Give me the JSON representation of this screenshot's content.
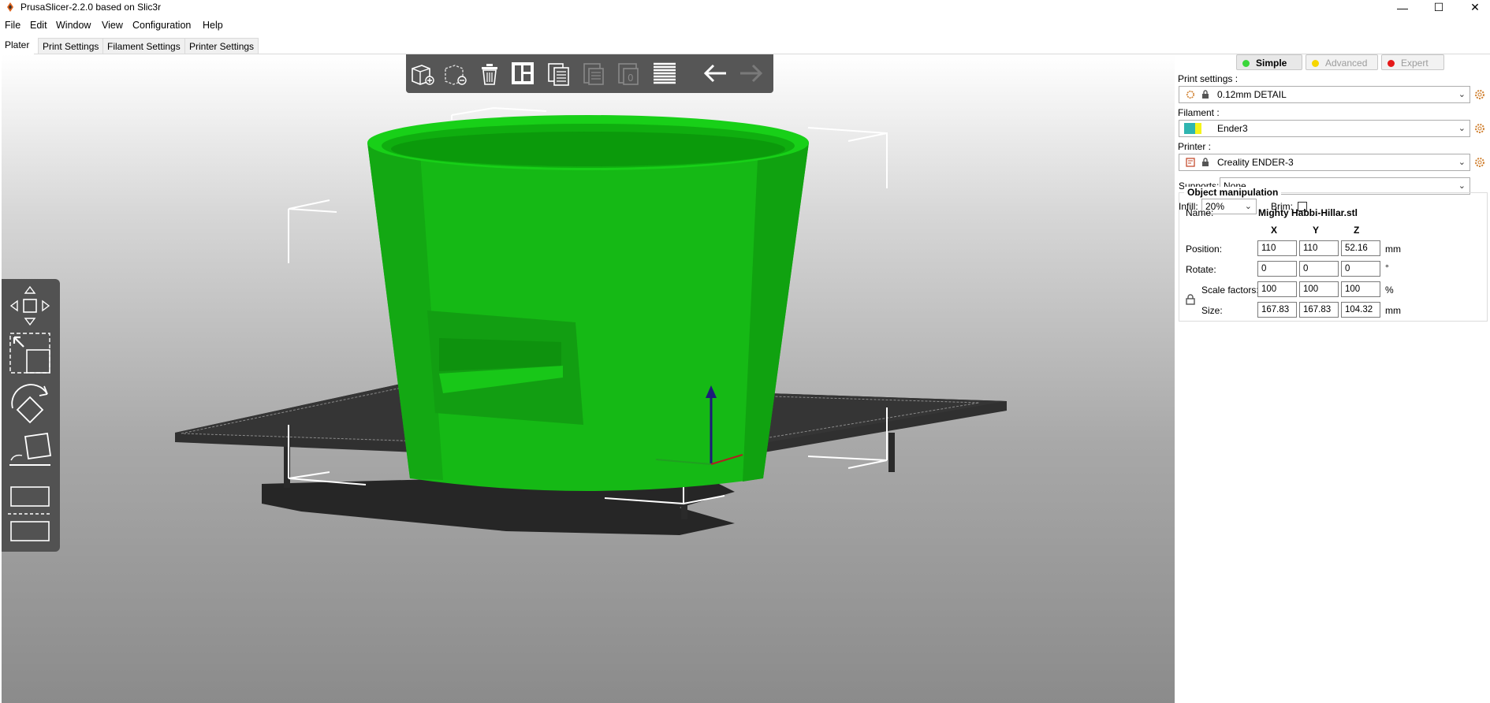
{
  "window": {
    "title": "PrusaSlicer-2.2.0 based on Slic3r",
    "minimize": "—",
    "maximize": "☐",
    "close": "✕"
  },
  "menu": [
    "File",
    "Edit",
    "Window",
    "View",
    "Configuration",
    "Help"
  ],
  "tabs": [
    "Plater",
    "Print Settings",
    "Filament Settings",
    "Printer Settings"
  ],
  "modes": {
    "simple": {
      "label": "Simple",
      "color": "#3ad63a"
    },
    "advanced": {
      "label": "Advanced",
      "color": "#f6d600"
    },
    "expert": {
      "label": "Expert",
      "color": "#e51919"
    }
  },
  "panel": {
    "print_settings_label": "Print settings :",
    "print_settings_value": "0.12mm DETAIL",
    "filament_label": "Filament :",
    "filament_value": "Ender3",
    "filament_colors": [
      "#2fb5b0",
      "#f5f51a"
    ],
    "printer_label": "Printer :",
    "printer_value": "Creality ENDER-3",
    "supports_label": "Supports:",
    "supports_value": "None",
    "infill_label": "Infill:",
    "infill_value": "20%",
    "brim_label": "Brim:"
  },
  "object_manipulation": {
    "legend": "Object manipulation",
    "name_label": "Name:",
    "name_value": "Mighty Habbi-Hillar.stl",
    "axes": [
      "X",
      "Y",
      "Z"
    ],
    "position_label": "Position:",
    "position": [
      "110",
      "110",
      "52.16"
    ],
    "position_unit": "mm",
    "rotate_label": "Rotate:",
    "rotate": [
      "0",
      "0",
      "0"
    ],
    "rotate_unit": "°",
    "scale_label": "Scale factors:",
    "scale": [
      "100",
      "100",
      "100"
    ],
    "scale_unit": "%",
    "size_label": "Size:",
    "size": [
      "167.83",
      "167.83",
      "104.32"
    ],
    "size_unit": "mm"
  },
  "toolbar_icons": [
    "add-icon",
    "delete-icon",
    "delete-all-icon",
    "arrange-icon",
    "copy-icon",
    "paste-icon",
    "instances-icon",
    "layers-icon",
    "undo-icon",
    "redo-icon"
  ],
  "gizmo_icons": [
    "move-icon",
    "scale-icon",
    "rotate-icon",
    "place-on-face-icon",
    "cut-icon"
  ],
  "colors": {
    "model": "#16c316",
    "bed": "#2b2b2b",
    "toolbar_bg": "#565656"
  }
}
